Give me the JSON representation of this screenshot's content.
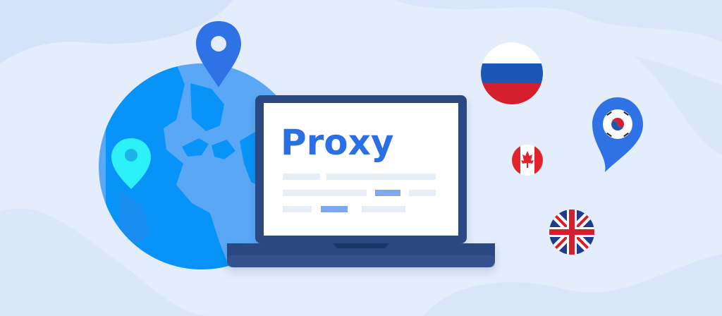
{
  "screen": {
    "title": "Proxy"
  },
  "colors": {
    "background": "#e3edfb",
    "background_waves": "#d4e3f8",
    "globe_ocean": "#5aa8f5",
    "globe_land": "#0793f7",
    "pin_blue": "#2f72e6",
    "pin_cyan": "#2df1f9",
    "laptop_frame": "#2c4a82",
    "laptop_screen": "#ffffff",
    "proxy_text": "#2a6fe3",
    "placeholder_gray": "#e8eef7",
    "placeholder_blue": "#7ea8ee"
  },
  "icons": [
    "globe-illustration",
    "location-pin-icon",
    "laptop-illustration",
    "russia-flag-icon",
    "canada-flag-icon",
    "south-korea-flag-pin-icon",
    "united-kingdom-flag-icon"
  ]
}
